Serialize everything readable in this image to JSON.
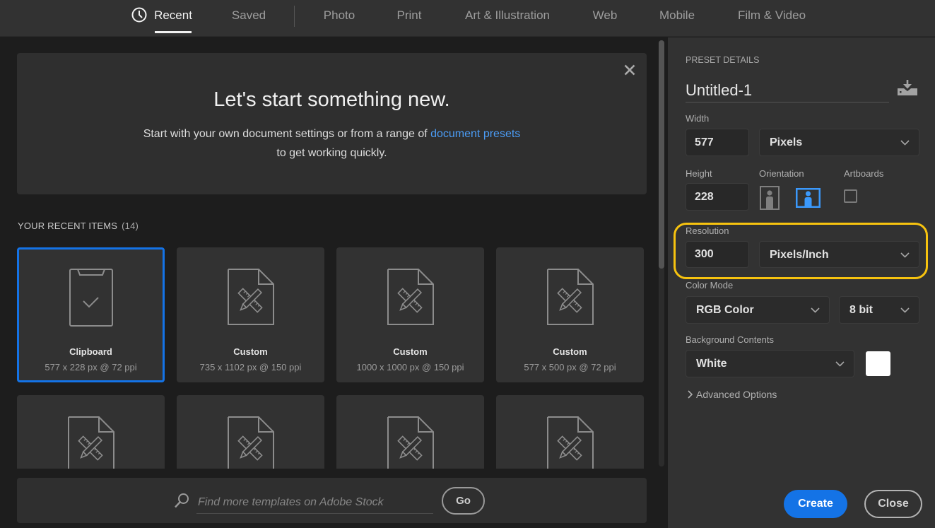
{
  "theme": {
    "accent": "#1473e6",
    "link": "#4b9cf5",
    "highlight": "#f7c30f",
    "orientation_active": "#3b99fc"
  },
  "tabs": [
    {
      "label": "Recent",
      "icon": "clock-icon",
      "active": true
    },
    {
      "label": "Saved",
      "active": false
    },
    {
      "label": "Photo",
      "active": false
    },
    {
      "label": "Print",
      "active": false
    },
    {
      "label": "Art & Illustration",
      "active": false
    },
    {
      "label": "Web",
      "active": false
    },
    {
      "label": "Mobile",
      "active": false
    },
    {
      "label": "Film & Video",
      "active": false
    }
  ],
  "banner": {
    "title": "Let's start something new.",
    "text_before": "Start with your own document settings or from a range of ",
    "link": "document presets",
    "text_after": "to get working quickly.",
    "close_icon": "close-icon"
  },
  "recent": {
    "heading": "YOUR RECENT ITEMS",
    "count": "(14)",
    "items": [
      {
        "name": "Clipboard",
        "details": "577 x 228 px @ 72 ppi",
        "icon": "clipboard-icon",
        "selected": true
      },
      {
        "name": "Custom",
        "details": "735 x 1102 px @ 150 ppi",
        "icon": "document-tools-icon",
        "selected": false
      },
      {
        "name": "Custom",
        "details": "1000 x 1000 px @ 150 ppi",
        "icon": "document-tools-icon",
        "selected": false
      },
      {
        "name": "Custom",
        "details": "577 x 500 px @ 72 ppi",
        "icon": "document-tools-icon",
        "selected": false
      },
      {
        "icon": "document-tools-icon",
        "selected": false
      },
      {
        "icon": "document-tools-icon",
        "selected": false
      },
      {
        "icon": "document-tools-icon",
        "selected": false
      },
      {
        "icon": "document-tools-icon",
        "selected": false
      }
    ]
  },
  "search": {
    "icon": "search-icon",
    "placeholder": "Find more templates on Adobe Stock",
    "value": "",
    "go_label": "Go"
  },
  "preset": {
    "heading": "PRESET DETAILS",
    "name": "Untitled-1",
    "save_icon": "save-preset-icon",
    "width": {
      "label": "Width",
      "value": "577",
      "unit": "Pixels"
    },
    "height": {
      "label": "Height",
      "value": "228"
    },
    "orientation": {
      "label": "Orientation",
      "selected": "landscape"
    },
    "artboards": {
      "label": "Artboards",
      "checked": false
    },
    "resolution": {
      "label": "Resolution",
      "value": "300",
      "unit": "Pixels/Inch",
      "highlighted": true
    },
    "color_mode": {
      "label": "Color Mode",
      "mode": "RGB Color",
      "depth": "8 bit"
    },
    "background": {
      "label": "Background Contents",
      "value": "White",
      "swatch": "#ffffff"
    },
    "advanced_label": "Advanced Options",
    "create_label": "Create",
    "close_label": "Close"
  }
}
